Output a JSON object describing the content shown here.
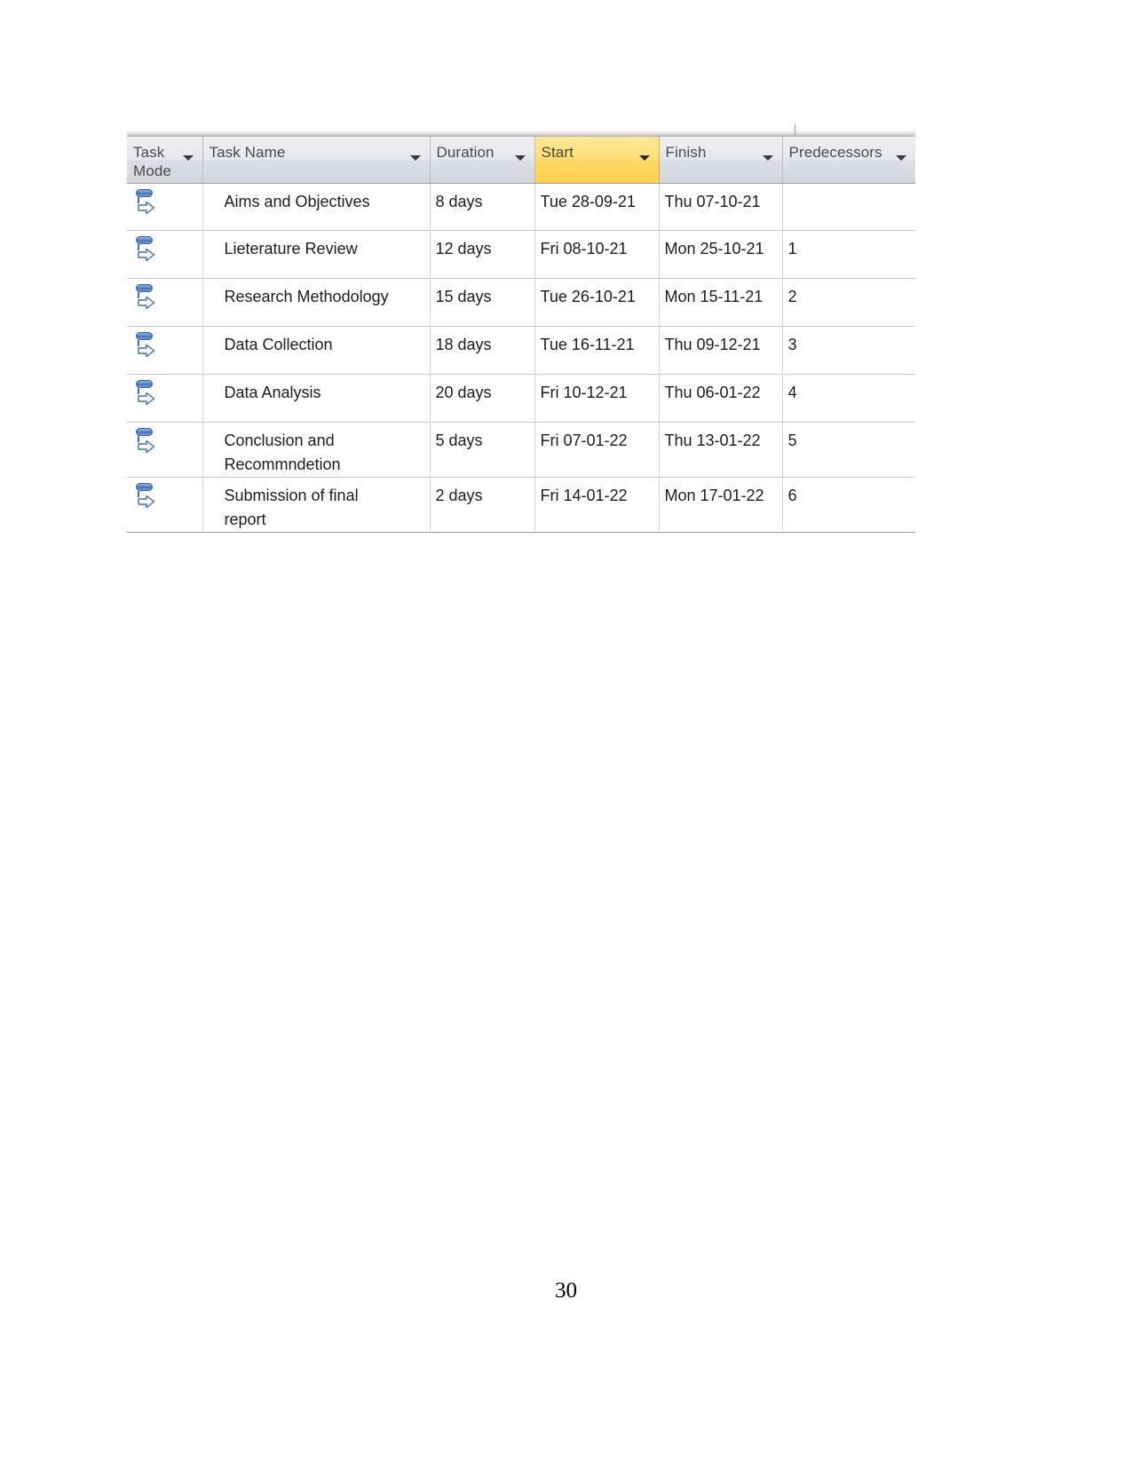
{
  "document": {
    "page_number": "30"
  },
  "project_table": {
    "icons": {
      "sort_arrow": "chevron-down-icon",
      "task_mode": "auto-scheduled-icon"
    },
    "colors": {
      "sorted_header": "#ffd964",
      "header_background": "#dcdfe5",
      "task_mode_icon": "#3f6eb0",
      "grid_line": "#c9c9c9"
    },
    "columns": [
      {
        "key": "task_mode",
        "label": "Task Mode",
        "sorted": false
      },
      {
        "key": "task_name",
        "label": "Task Name",
        "sorted": false
      },
      {
        "key": "duration",
        "label": "Duration",
        "sorted": false
      },
      {
        "key": "start",
        "label": "Start",
        "sorted": true
      },
      {
        "key": "finish",
        "label": "Finish",
        "sorted": false
      },
      {
        "key": "predecessors",
        "label": "Predecessors",
        "sorted": false
      }
    ],
    "rows": [
      {
        "task_mode": "Auto Scheduled",
        "task_name": "Aims and Objectives",
        "duration": "8 days",
        "start": "Tue 28-09-21",
        "finish": "Thu 07-10-21",
        "predecessors": ""
      },
      {
        "task_mode": "Auto Scheduled",
        "task_name": "Lieterature Review",
        "duration": "12 days",
        "start": "Fri 08-10-21",
        "finish": "Mon 25-10-21",
        "predecessors": "1"
      },
      {
        "task_mode": "Auto Scheduled",
        "task_name": "Research Methodology",
        "duration": "15 days",
        "start": "Tue 26-10-21",
        "finish": "Mon 15-11-21",
        "predecessors": "2"
      },
      {
        "task_mode": "Auto Scheduled",
        "task_name": "Data Collection",
        "duration": "18 days",
        "start": "Tue 16-11-21",
        "finish": "Thu 09-12-21",
        "predecessors": "3"
      },
      {
        "task_mode": "Auto Scheduled",
        "task_name": "Data Analysis",
        "duration": "20 days",
        "start": "Fri 10-12-21",
        "finish": "Thu 06-01-22",
        "predecessors": "4"
      },
      {
        "task_mode": "Auto Scheduled",
        "task_name": "Conclusion and\nRecommndetion",
        "duration": "5 days",
        "start": "Fri 07-01-22",
        "finish": "Thu 13-01-22",
        "predecessors": "5"
      },
      {
        "task_mode": "Auto Scheduled",
        "task_name": "Submission of final\nreport",
        "duration": "2 days",
        "start": "Fri 14-01-22",
        "finish": "Mon 17-01-22",
        "predecessors": "6"
      }
    ]
  }
}
